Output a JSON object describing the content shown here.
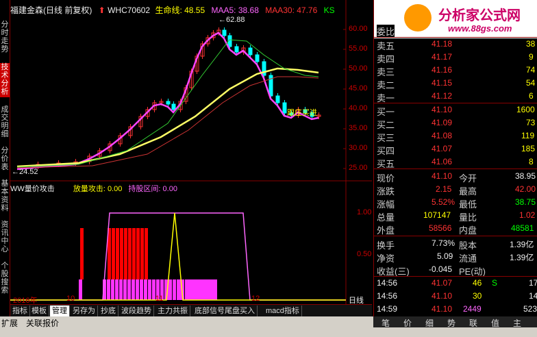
{
  "left_tabs": [
    "分时走势",
    "技术分析",
    "成交明细",
    "分价表",
    "基本资料",
    "资讯中心",
    "个股搜索"
  ],
  "header": {
    "stock": "福建金森(日线 前复权)",
    "indicator": "WHC70602",
    "life_line": "生命线: 48.55",
    "ma5": "MAA5: 38.68",
    "ma30": "MAA30: 47.76",
    "ks": "KS"
  },
  "price_axis": [
    "60.00",
    "55.00",
    "50.00",
    "45.00",
    "40.00",
    "35.00",
    "30.00",
    "25.00"
  ],
  "annotations": {
    "high": "62.88",
    "low": "24.52",
    "follow": "跟庄买进"
  },
  "sub_header": {
    "name": "WW量价攻击",
    "attack": "放量攻击: 0.00",
    "hold": "持股区间: 0.00"
  },
  "sub_axis": [
    "1.00",
    "0.50"
  ],
  "date_axis": {
    "d1": "2016年",
    "d2": "10",
    "d3": "11",
    "d4": "12",
    "period": "日线"
  },
  "bottom_tabs": [
    "指标",
    "模板",
    "管理",
    "另存为",
    "抄底",
    "波段趋势",
    "主力共振",
    "底部信号尾盘买入",
    "macd指标"
  ],
  "active_bottom_tab": "管理",
  "status_left": [
    "扩展",
    "关联报价"
  ],
  "logo": {
    "title": "分析家公式网",
    "url": "www.88gs.com"
  },
  "orderbook": {
    "weibi": "委比",
    "asks": [
      {
        "label": "卖五",
        "price": "41.18",
        "vol": "38"
      },
      {
        "label": "卖四",
        "price": "41.17",
        "vol": "9"
      },
      {
        "label": "卖三",
        "price": "41.16",
        "vol": "74"
      },
      {
        "label": "卖二",
        "price": "41.15",
        "vol": "54"
      },
      {
        "label": "卖一",
        "price": "41.12",
        "vol": "6"
      }
    ],
    "bids": [
      {
        "label": "买一",
        "price": "41.10",
        "vol": "1600"
      },
      {
        "label": "买二",
        "price": "41.09",
        "vol": "73"
      },
      {
        "label": "买三",
        "price": "41.08",
        "vol": "119"
      },
      {
        "label": "买四",
        "price": "41.07",
        "vol": "185"
      },
      {
        "label": "买五",
        "price": "41.06",
        "vol": "8"
      }
    ]
  },
  "quote": [
    {
      "l1": "现价",
      "v1": "41.10",
      "l2": "今开",
      "v2": "38.95"
    },
    {
      "l1": "涨跌",
      "v1": "2.15",
      "l2": "最高",
      "v2": "42.00"
    },
    {
      "l1": "涨幅",
      "v1": "5.52%",
      "l2": "最低",
      "v2": "38.75"
    },
    {
      "l1": "总量",
      "v1": "107147",
      "l2": "量比",
      "v2": "1.02"
    },
    {
      "l1": "外盘",
      "v1": "58566",
      "l2": "内盘",
      "v2": "48581"
    }
  ],
  "fundamentals": [
    {
      "l1": "换手",
      "v1": "7.73%",
      "l2": "股本",
      "v2": "1.39亿"
    },
    {
      "l1": "净资",
      "v1": "5.09",
      "l2": "流通",
      "v2": "1.39亿"
    },
    {
      "l1": "收益(三)",
      "v1": "-0.045",
      "l2": "PE(动)",
      "v2": ""
    }
  ],
  "ticks": [
    {
      "time": "14:56",
      "price": "41.07",
      "vol": "46",
      "flag": "S",
      "extra": "17"
    },
    {
      "time": "14:56",
      "price": "41.10",
      "vol": "30",
      "flag": "",
      "extra": "14"
    },
    {
      "time": "14:59",
      "price": "41.10",
      "vol": "2449",
      "flag": "",
      "extra": "523"
    }
  ],
  "right_tabs": [
    "笔",
    "价",
    "细",
    "势",
    "联",
    "值",
    "主"
  ]
}
